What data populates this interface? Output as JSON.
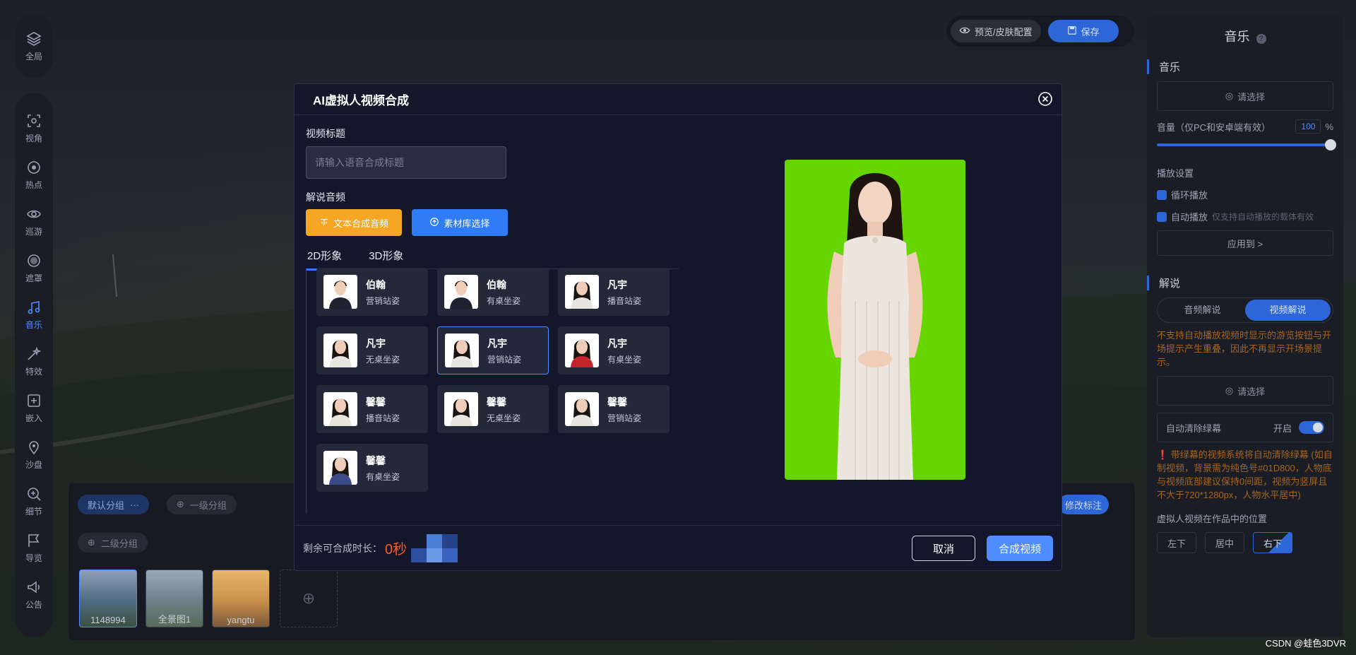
{
  "rail_top": {
    "label": "全局",
    "icon": "layers-icon"
  },
  "rail": [
    {
      "label": "视角",
      "icon": "view-icon",
      "active": false
    },
    {
      "label": "热点",
      "icon": "hotspot-icon",
      "active": false
    },
    {
      "label": "巡游",
      "icon": "tour-icon",
      "active": false
    },
    {
      "label": "遮罩",
      "icon": "mask-icon",
      "active": false
    },
    {
      "label": "音乐",
      "icon": "music-icon",
      "active": true
    },
    {
      "label": "特效",
      "icon": "effects-icon",
      "active": false
    },
    {
      "label": "嵌入",
      "icon": "embed-icon",
      "active": false
    },
    {
      "label": "沙盘",
      "icon": "sandbox-icon",
      "active": false
    },
    {
      "label": "细节",
      "icon": "zoom-icon",
      "active": false
    },
    {
      "label": "导览",
      "icon": "guide-icon",
      "active": false
    },
    {
      "label": "公告",
      "icon": "announce-icon",
      "active": false
    }
  ],
  "topbar": {
    "preview_label": "预览/皮肤配置",
    "save_label": "保存"
  },
  "rpanel": {
    "title": "音乐",
    "music_sec": "音乐",
    "select_label": "请选择",
    "volume_label": "音量（仅PC和安卓端有效）",
    "volume_value": "100",
    "volume_unit": "%",
    "play_settings": "播放设置",
    "loop_label": "循环播放",
    "autoplay_label": "自动播放",
    "autoplay_hint": "仅支持自动播放的载体有效",
    "apply_label": "应用到 >",
    "narration_sec": "解说",
    "seg_audio": "音频解说",
    "seg_video": "视频解说",
    "warn1": "不支持自动播放视频时显示的游览按钮与开场提示产生重叠，因此不再显示开场景提示。",
    "select2_label": "请选择",
    "auto_clear": "自动清除绿幕",
    "auto_clear_state": "开启",
    "warn2": "❗ 带绿幕的视频系统将自动清除绿幕 (如自制视频，背景需为纯色号#01D800，人物底与视频底部建议保持0间距，视频为竖屏且不大于720*1280px，人物水平居中)",
    "position_label": "虚拟人视频在作品中的位置",
    "positions": [
      "左下",
      "居中",
      "右下"
    ]
  },
  "bottom": {
    "group_default": "默认分组",
    "group_first": "一级分组",
    "group_second": "二级分组",
    "modify_label": "修改标注",
    "thumbs": [
      "1148994",
      "全景图1",
      "yangtu"
    ]
  },
  "modal": {
    "title": "AI虚拟人视频合成",
    "video_title_label": "视频标题",
    "video_title_placeholder": "请输入语音合成标题",
    "video_title_value": "",
    "narration_label": "解说音频",
    "btn_tts": "文本合成音频",
    "btn_lib": "素材库选择",
    "tab_2d": "2D形象",
    "tab_3d": "3D形象",
    "avatars": [
      {
        "name": "伯翰",
        "pose": "营销站姿",
        "gender": "m",
        "selected": false
      },
      {
        "name": "伯翰",
        "pose": "有桌坐姿",
        "gender": "m",
        "selected": false
      },
      {
        "name": "凡宇",
        "pose": "播音站姿",
        "gender": "f",
        "selected": false
      },
      {
        "name": "凡宇",
        "pose": "无桌坐姿",
        "gender": "f",
        "selected": false
      },
      {
        "name": "凡宇",
        "pose": "营销站姿",
        "gender": "f",
        "selected": true
      },
      {
        "name": "凡宇",
        "pose": "有桌坐姿",
        "gender": "fr",
        "selected": false
      },
      {
        "name": "馨馨",
        "pose": "播音站姿",
        "gender": "f",
        "selected": false
      },
      {
        "name": "馨馨",
        "pose": "无桌坐姿",
        "gender": "f",
        "selected": false
      },
      {
        "name": "馨馨",
        "pose": "营销站姿",
        "gender": "f",
        "selected": false
      },
      {
        "name": "馨馨",
        "pose": "有桌坐姿",
        "gender": "fb",
        "selected": false
      }
    ],
    "remain_label": "剩余可合成时长：",
    "remain_value": "0秒",
    "cancel_label": "取消",
    "ok_label": "合成视频"
  },
  "colors": {
    "accent": "#2f7cf6",
    "orange": "#f5a623",
    "green_screen": "#66d600",
    "warn": "#ff5a2a"
  },
  "watermark": "CSDN @蛙色3DVR"
}
